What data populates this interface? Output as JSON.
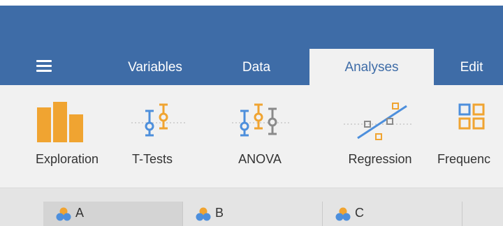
{
  "menu": {
    "icon": "hamburger-menu-icon"
  },
  "tabs": [
    {
      "label": "Variables"
    },
    {
      "label": "Data"
    },
    {
      "label": "Analyses",
      "active": true
    },
    {
      "label": "Edit"
    }
  ],
  "ribbon": {
    "exploration": {
      "label": "Exploration",
      "icon": "exploration-bars-icon"
    },
    "ttests": {
      "label": "T-Tests",
      "icon": "ttests-icon"
    },
    "anova": {
      "label": "ANOVA",
      "icon": "anova-icon"
    },
    "regression": {
      "label": "Regression",
      "icon": "regression-icon"
    },
    "frequencies": {
      "label": "Frequenc",
      "icon": "frequencies-icon"
    }
  },
  "columns": [
    {
      "name": "A",
      "icon": "nominal-variable-icon"
    },
    {
      "name": "B",
      "icon": "nominal-variable-icon"
    },
    {
      "name": "C",
      "icon": "nominal-variable-icon"
    }
  ],
  "colors": {
    "header_blue": "#3e6ca7",
    "ribbon_bg": "#f1f1f1",
    "icon_orange": "#f0a431",
    "icon_blue": "#4d8fdc",
    "icon_gray": "#8a8a8a"
  }
}
